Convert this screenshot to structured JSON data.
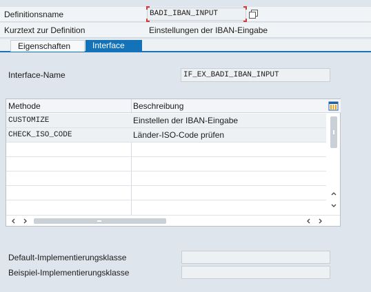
{
  "header": {
    "definitionsname_label": "Definitionsname",
    "definitionsname_value": "BADI_IBAN_INPUT",
    "kurztext_label": "Kurztext zur Definition",
    "kurztext_value": "Einstellungen der IBAN-Eingabe"
  },
  "tabs": [
    {
      "label": "Eigenschaften",
      "active": false
    },
    {
      "label": "Interface",
      "active": true
    }
  ],
  "interface": {
    "name_label": "Interface-Name",
    "name_value": "IF_EX_BADI_IBAN_INPUT"
  },
  "table": {
    "columns": [
      "Methode",
      "Beschreibung"
    ],
    "rows": [
      {
        "method": "CUSTOMIZE",
        "description": "Einstellen der IBAN-Eingabe"
      },
      {
        "method": "CHECK_ISO_CODE",
        "description": "Länder-ISO-Code prüfen"
      }
    ]
  },
  "footer": {
    "default_label": "Default-Implementierungsklasse",
    "default_value": "",
    "beispiel_label": "Beispiel-Implementierungsklasse",
    "beispiel_value": ""
  },
  "icons": {
    "copy": "copy-icon",
    "layout": "column-layout-icon",
    "scroll_up": "chevron-up-icon",
    "scroll_down": "chevron-down-icon",
    "scroll_left": "chevron-left-icon",
    "scroll_right": "chevron-right-icon"
  },
  "colors": {
    "active_tab": "#1473b8",
    "background": "#dfe5ec",
    "focus_corners": "#d23b3b"
  }
}
